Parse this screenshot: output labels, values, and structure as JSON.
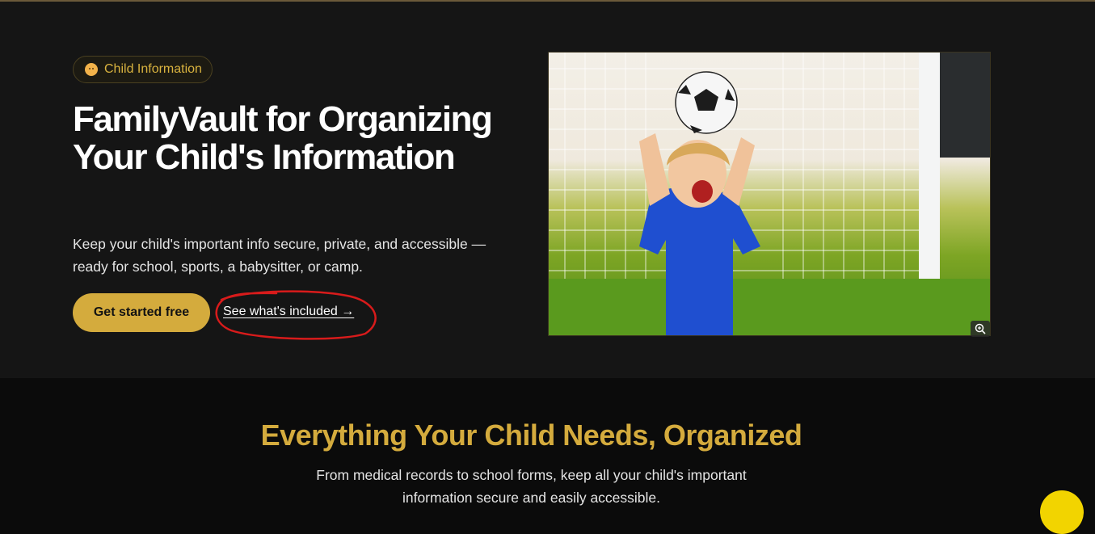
{
  "hero": {
    "badge_label": "Child Information",
    "badge_icon": "baby-face-icon",
    "title": "FamilyVault for Organizing Your Child's Information",
    "description": "Keep your child's important info secure, private, and accessible — ready for school, sports, a babysitter, or camp.",
    "primary_button": "Get started free",
    "secondary_link": "See what's included →",
    "image_icon": "zoom-in-icon"
  },
  "features": {
    "title": "Everything Your Child Needs, Organized",
    "subtitle": "From medical records to school forms, keep all your child's important information secure and easily accessible."
  },
  "colors": {
    "accent": "#d4ab3d",
    "background": "#151515",
    "annotation": "#d81b1b"
  }
}
